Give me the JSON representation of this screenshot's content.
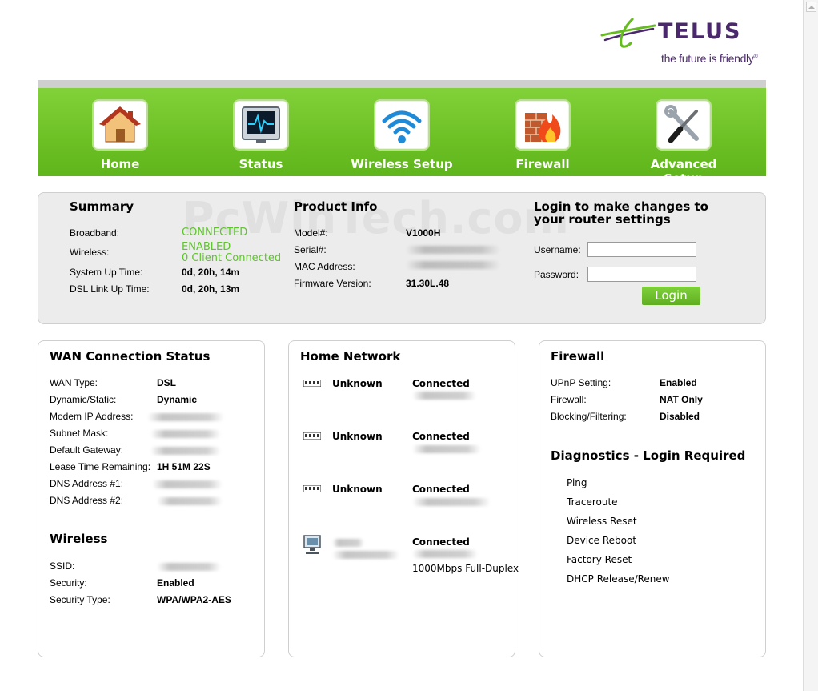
{
  "logo": {
    "wordmark": "TELUS",
    "tagline": "the future is friendly",
    "tagline_mark": "®"
  },
  "nav": [
    {
      "label": "Home",
      "icon": "house-icon"
    },
    {
      "label": "Status",
      "icon": "monitor-icon"
    },
    {
      "label": "Wireless Setup",
      "icon": "wifi-icon"
    },
    {
      "label": "Firewall",
      "icon": "firewall-icon"
    },
    {
      "label": "Advanced Setup",
      "icon": "tools-icon"
    }
  ],
  "summary": {
    "title": "Summary",
    "broadband_label": "Broadband:",
    "broadband_value": "CONNECTED",
    "wireless_label": "Wireless:",
    "wireless_value": "ENABLED",
    "wireless_clients": "0 Client Connected",
    "uptime_label": "System Up Time:",
    "uptime_value": "0d, 20h, 14m",
    "dsl_label": "DSL Link Up Time:",
    "dsl_value": "0d, 20h, 13m",
    "watermark": "PcWinTech.com"
  },
  "product": {
    "title": "Product Info",
    "model_label": "Model#:",
    "model_value": "V1000H",
    "serial_label": "Serial#:",
    "mac_label": "MAC Address:",
    "firmware_label": "Firmware Version:",
    "firmware_value": "31.30L.48"
  },
  "login": {
    "title_line1": "Login to make changes to",
    "title_line2": "your router settings",
    "username_label": "Username:",
    "password_label": "Password:",
    "username_value": "",
    "password_value": "",
    "button": "Login"
  },
  "wan": {
    "title": "WAN Connection Status",
    "rows": [
      {
        "label": "WAN Type:",
        "value": "DSL"
      },
      {
        "label": "Dynamic/Static:",
        "value": "Dynamic"
      },
      {
        "label": "Modem IP Address:",
        "value": ""
      },
      {
        "label": "Subnet Mask:",
        "value": ""
      },
      {
        "label": "Default Gateway:",
        "value": ""
      },
      {
        "label": "Lease Time Remaining:",
        "value": "1H 51M 22S"
      },
      {
        "label": "DNS Address #1:",
        "value": ""
      },
      {
        "label": "DNS Address #2:",
        "value": ""
      }
    ],
    "wireless_title": "Wireless",
    "wireless_rows": [
      {
        "label": "SSID:",
        "value": ""
      },
      {
        "label": "Security:",
        "value": "Enabled"
      },
      {
        "label": "Security Type:",
        "value": "WPA/WPA2-AES"
      }
    ]
  },
  "home_network": {
    "title": "Home Network",
    "devices": [
      {
        "name": "Unknown",
        "status": "Connected",
        "extra": ""
      },
      {
        "name": "Unknown",
        "status": "Connected",
        "extra": ""
      },
      {
        "name": "Unknown",
        "status": "Connected",
        "extra": ""
      },
      {
        "name": "",
        "status": "Connected",
        "extra": "1000Mbps Full-Duplex"
      }
    ]
  },
  "firewall": {
    "title": "Firewall",
    "rows": [
      {
        "label": "UPnP Setting:",
        "value": "Enabled"
      },
      {
        "label": "Firewall:",
        "value": "NAT Only"
      },
      {
        "label": "Blocking/Filtering:",
        "value": "Disabled"
      }
    ],
    "diag_title": "Diagnostics - Login Required",
    "diag_links": [
      "Ping",
      "Traceroute",
      "Wireless Reset",
      "Device Reboot",
      "Factory Reset",
      "DHCP Release/Renew"
    ]
  },
  "colors": {
    "brand_purple": "#4b286d",
    "brand_green": "#66bb22",
    "status_green": "#5ec42b"
  }
}
